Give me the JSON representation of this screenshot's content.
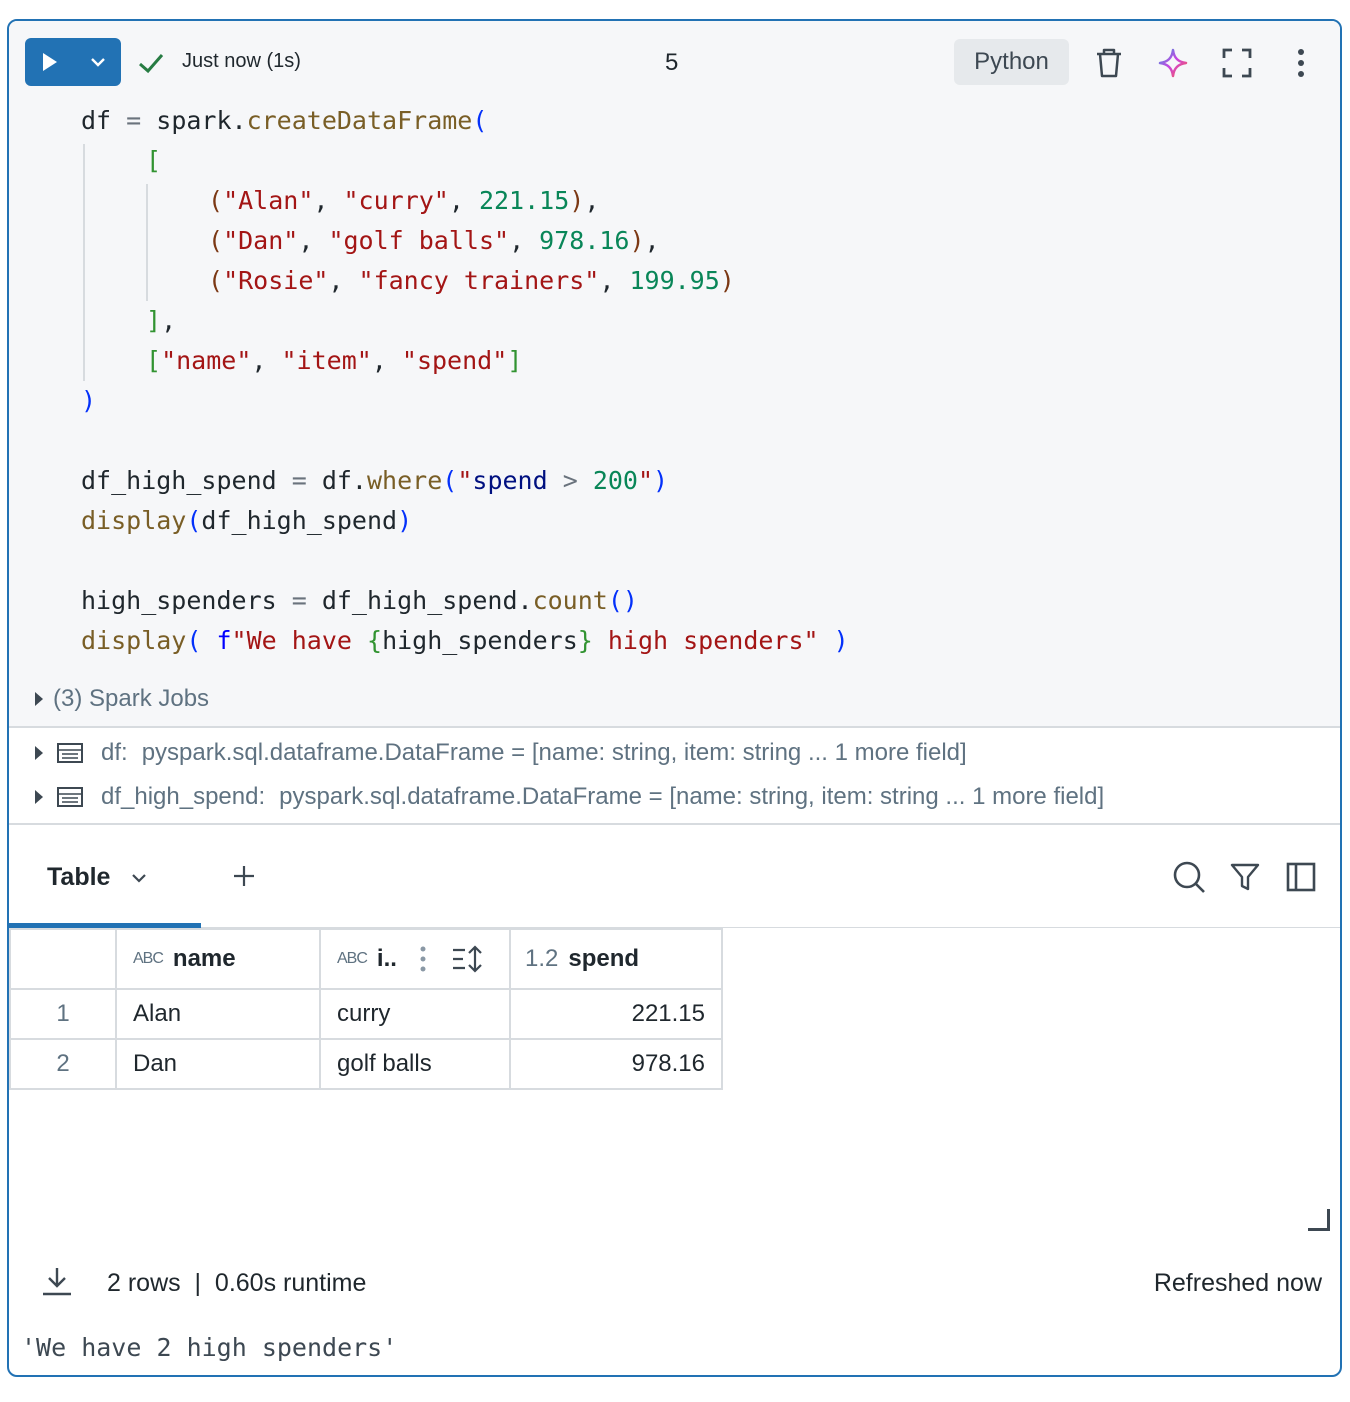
{
  "toolbar": {
    "status_text": "Just now (1s)",
    "cell_number": "5",
    "language": "Python"
  },
  "code": {
    "lines": [
      "df = spark.createDataFrame(",
      "[",
      "(\"Alan\", \"curry\", 221.15),",
      "(\"Dan\", \"golf balls\", 978.16),",
      "(\"Rosie\", \"fancy trainers\", 199.95)",
      "],",
      "[\"name\", \"item\", \"spend\"]",
      ")",
      "",
      "df_high_spend = df.where(\"spend > 200\")",
      "display(df_high_spend)",
      "",
      "high_spenders = df_high_spend.count()",
      "display( f\"We have {high_spenders} high spenders\" )"
    ]
  },
  "spark_jobs": "(3) Spark Jobs",
  "schemas": [
    {
      "name": "df:",
      "type": "pyspark.sql.dataframe.DataFrame = [name: string, item: string ... 1 more field]"
    },
    {
      "name": "df_high_spend:",
      "type": "pyspark.sql.dataframe.DataFrame = [name: string, item: string ... 1 more field]"
    }
  ],
  "results": {
    "tab_label": "Table",
    "columns": [
      {
        "type": "ABC",
        "label": "name"
      },
      {
        "type": "ABC",
        "label": "i.."
      },
      {
        "type": "1.2",
        "label": "spend"
      }
    ],
    "rows": [
      {
        "index": "1",
        "name": "Alan",
        "item": "curry",
        "spend": "221.15"
      },
      {
        "index": "2",
        "name": "Dan",
        "item": "golf balls",
        "spend": "978.16"
      }
    ]
  },
  "footer": {
    "rows_runtime": "2 rows  |  0.60s runtime",
    "refreshed": "Refreshed now"
  },
  "output": "'We have 2 high spenders'",
  "colors": {
    "accent": "#2272b4",
    "success": "#277c43",
    "code_background": "#f6f7f9"
  }
}
